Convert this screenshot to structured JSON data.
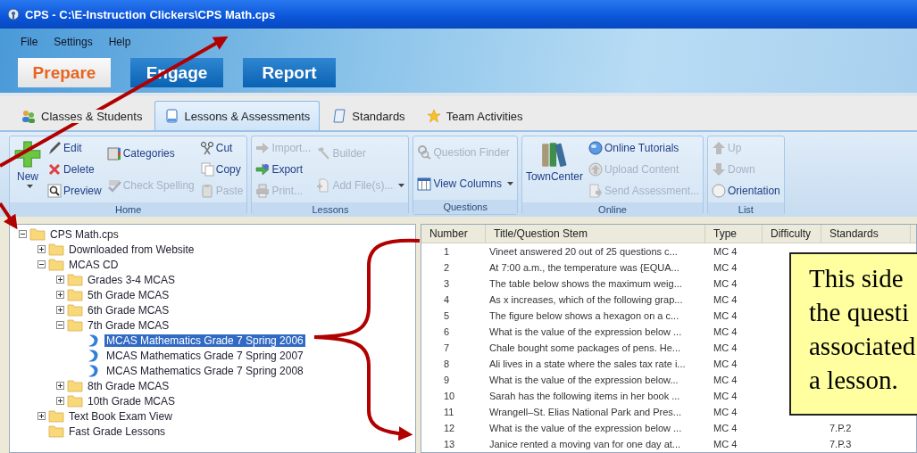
{
  "window": {
    "title": "CPS - C:\\E-Instruction Clickers\\CPS Math.cps"
  },
  "menu": [
    "File",
    "Settings",
    "Help"
  ],
  "main_tabs": [
    {
      "label": "Prepare",
      "selected": true
    },
    {
      "label": "Engage",
      "selected": false
    },
    {
      "label": "Report",
      "selected": false
    }
  ],
  "sub_tabs": [
    {
      "label": "Classes & Students",
      "selected": false
    },
    {
      "label": "Lessons & Assessments",
      "selected": true
    },
    {
      "label": "Standards",
      "selected": false
    },
    {
      "label": "Team Activities",
      "selected": false
    }
  ],
  "ribbon": {
    "groups": [
      {
        "title": "Home",
        "columns": [
          [
            {
              "label": "New",
              "kind": "large",
              "disabled": false,
              "dropdown": true
            }
          ],
          [
            {
              "label": "Edit",
              "kind": "small",
              "disabled": false
            },
            {
              "label": "Delete",
              "kind": "small",
              "disabled": false
            },
            {
              "label": "Preview",
              "kind": "small",
              "disabled": false
            }
          ],
          [
            {
              "label": "Categories",
              "kind": "small",
              "disabled": false
            },
            {
              "label": "Check Spelling",
              "kind": "small",
              "disabled": true
            }
          ],
          [
            {
              "label": "Cut",
              "kind": "small",
              "disabled": false
            },
            {
              "label": "Copy",
              "kind": "small",
              "disabled": false
            },
            {
              "label": "Paste",
              "kind": "small",
              "disabled": true
            }
          ]
        ]
      },
      {
        "title": "Lessons",
        "columns": [
          [
            {
              "label": "Import...",
              "kind": "small",
              "disabled": true
            },
            {
              "label": "Export",
              "kind": "small",
              "disabled": false
            },
            {
              "label": "Print...",
              "kind": "small",
              "disabled": true
            }
          ],
          [
            {
              "label": "Builder",
              "kind": "small",
              "disabled": true
            },
            {
              "label": "Add File(s)...",
              "kind": "small",
              "disabled": true,
              "dropdown": true
            }
          ]
        ]
      },
      {
        "title": "Questions",
        "columns": [
          [
            {
              "label": "Question Finder",
              "kind": "small",
              "disabled": true
            },
            {
              "label": "View Columns",
              "kind": "small",
              "disabled": false,
              "dropdown": true
            }
          ]
        ]
      },
      {
        "title": "Online",
        "columns": [
          [
            {
              "label": "TownCenter",
              "kind": "large",
              "disabled": false
            }
          ],
          [
            {
              "label": "Online Tutorials",
              "kind": "small",
              "disabled": false
            },
            {
              "label": "Upload Content",
              "kind": "small",
              "disabled": true
            },
            {
              "label": "Send Assessment...",
              "kind": "small",
              "disabled": true
            }
          ]
        ]
      },
      {
        "title": "List",
        "columns": [
          [
            {
              "label": "Up",
              "kind": "small",
              "disabled": true
            },
            {
              "label": "Down",
              "kind": "small",
              "disabled": true
            },
            {
              "label": "Orientation",
              "kind": "small",
              "disabled": false
            }
          ]
        ]
      }
    ]
  },
  "tree": [
    {
      "label": "CPS Math.cps",
      "kind": "folder",
      "expanded": true,
      "selected": false,
      "children": [
        {
          "label": "Downloaded from Website",
          "kind": "folder",
          "expanded": false,
          "selected": false
        },
        {
          "label": "MCAS CD",
          "kind": "folder",
          "expanded": true,
          "selected": false,
          "children": [
            {
              "label": "Grades 3-4 MCAS",
              "kind": "folder",
              "expanded": false,
              "selected": false
            },
            {
              "label": "5th Grade MCAS",
              "kind": "folder",
              "expanded": false,
              "selected": false
            },
            {
              "label": "6th Grade MCAS",
              "kind": "folder",
              "expanded": false,
              "selected": false
            },
            {
              "label": "7th Grade MCAS",
              "kind": "folder",
              "expanded": true,
              "selected": false,
              "children": [
                {
                  "label": "MCAS Mathematics Grade 7 Spring 2006",
                  "kind": "lesson",
                  "selected": true
                },
                {
                  "label": "MCAS Mathematics Grade 7 Spring 2007",
                  "kind": "lesson",
                  "selected": false
                },
                {
                  "label": "MCAS Mathematics Grade 7 Spring 2008",
                  "kind": "lesson",
                  "selected": false
                }
              ]
            },
            {
              "label": "8th Grade MCAS",
              "kind": "folder",
              "expanded": false,
              "selected": false
            },
            {
              "label": "10th Grade MCAS",
              "kind": "folder",
              "expanded": false,
              "selected": false
            }
          ]
        },
        {
          "label": "Text Book Exam View",
          "kind": "folder",
          "expanded": false,
          "selected": false
        },
        {
          "label": "Fast Grade Lessons",
          "kind": "folder",
          "selected": false
        }
      ]
    }
  ],
  "table": {
    "columns": [
      "Number",
      "Title/Question Stem",
      "Type",
      "Difficulty",
      "Standards"
    ],
    "rows": [
      {
        "number": "1",
        "title": "Vineet answered 20 out of 25 questions c...",
        "type": "MC 4"
      },
      {
        "number": "2",
        "title": "At 7:00 a.m., the temperature was {EQUA...",
        "type": "MC 4"
      },
      {
        "number": "3",
        "title": "The table below shows the maximum weig...",
        "type": "MC 4"
      },
      {
        "number": "4",
        "title": "As x increases, which of the following grap...",
        "type": "MC 4"
      },
      {
        "number": "5",
        "title": "The figure below shows a hexagon on a c...",
        "type": "MC 4"
      },
      {
        "number": "6",
        "title": "What is the value of the expression below ...",
        "type": "MC 4"
      },
      {
        "number": "7",
        "title": "Chale bought some packages of pens. He...",
        "type": "MC 4"
      },
      {
        "number": "8",
        "title": "Ali lives in a state where the sales tax rate i...",
        "type": "MC 4"
      },
      {
        "number": "9",
        "title": "What is the value of the expression below...",
        "type": "MC 4"
      },
      {
        "number": "10",
        "title": "Sarah has the following items in her book ...",
        "type": "MC 4"
      },
      {
        "number": "11",
        "title": "Wrangell–St. Elias National Park and Pres...",
        "type": "MC 4"
      },
      {
        "number": "12",
        "title": "What is the value of the expression below ...",
        "type": "MC 4",
        "standards": "7.P.2"
      },
      {
        "number": "13",
        "title": "Janice rented a moving van for one day at...",
        "type": "MC 4",
        "standards": "7.P.3"
      }
    ]
  },
  "callout": {
    "lines": [
      "This side",
      "the questi",
      "associated",
      "a lesson."
    ]
  }
}
